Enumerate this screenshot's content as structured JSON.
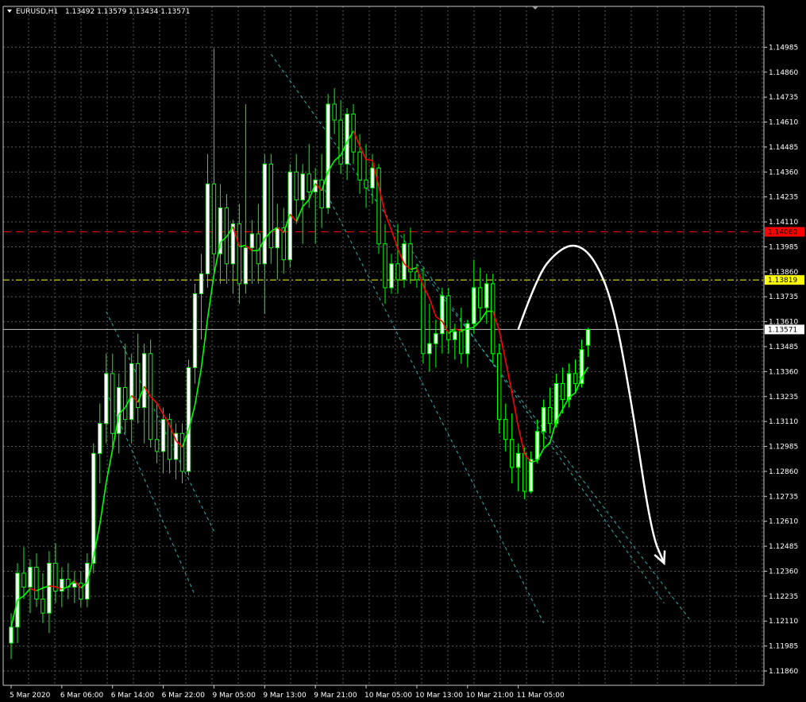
{
  "colors": {
    "background": "#000000",
    "grid": "#5a5a5a",
    "bull_body": "#ffffff",
    "bull_outline": "#00ff00",
    "bear_body": "#000000",
    "bear_outline": "#00ff00",
    "wick": "#00ff00",
    "ma_up": "#00ff00",
    "ma_down": "#ff0000",
    "channel": "#20b2aa",
    "resistance": "#ff0000",
    "support": "#ffff00",
    "current": "#c0c0c0",
    "projection": "#ffffff"
  },
  "chart_data": {
    "type": "candlestick",
    "symbol": "EURUSD,H1",
    "header": {
      "symbol_label": "EURUSD,H1",
      "ohlc_text": "1.13492 1.13579 1.13434 1.13571"
    },
    "ylim": [
      1.1186,
      1.1511
    ],
    "y_ticks": [
      "1.14985",
      "1.14860",
      "1.14735",
      "1.14610",
      "1.14485",
      "1.14360",
      "1.14235",
      "1.14110",
      "1.13985",
      "1.13860",
      "1.13735",
      "1.13610",
      "1.13485",
      "1.13360",
      "1.13235",
      "1.13110",
      "1.12985",
      "1.12860",
      "1.12735",
      "1.12610",
      "1.12485",
      "1.12360",
      "1.12235",
      "1.12110",
      "1.11985",
      "1.11860"
    ],
    "x_tick_labels": [
      "5 Mar 2020",
      "6 Mar 06:00",
      "6 Mar 14:00",
      "6 Mar 22:00",
      "9 Mar 05:00",
      "9 Mar 13:00",
      "9 Mar 21:00",
      "10 Mar 05:00",
      "10 Mar 13:00",
      "10 Mar 21:00",
      "11 Mar 05:00"
    ],
    "x_tick_bars": [
      0,
      8,
      16,
      24,
      32,
      40,
      48,
      56,
      64,
      72,
      80
    ],
    "bars_visible_span": 120,
    "candles": [
      {
        "o": 1.12,
        "h": 1.1215,
        "l": 1.1192,
        "c": 1.1208
      },
      {
        "o": 1.1208,
        "h": 1.124,
        "l": 1.12,
        "c": 1.1235
      },
      {
        "o": 1.1235,
        "h": 1.1248,
        "l": 1.1222,
        "c": 1.1228
      },
      {
        "o": 1.1228,
        "h": 1.1242,
        "l": 1.1215,
        "c": 1.1238
      },
      {
        "o": 1.1238,
        "h": 1.1245,
        "l": 1.1218,
        "c": 1.1222
      },
      {
        "o": 1.1222,
        "h": 1.1235,
        "l": 1.121,
        "c": 1.1215
      },
      {
        "o": 1.1215,
        "h": 1.1246,
        "l": 1.1205,
        "c": 1.124
      },
      {
        "o": 1.124,
        "h": 1.125,
        "l": 1.122,
        "c": 1.1226
      },
      {
        "o": 1.1226,
        "h": 1.1238,
        "l": 1.1218,
        "c": 1.1232
      },
      {
        "o": 1.1232,
        "h": 1.124,
        "l": 1.1222,
        "c": 1.1228
      },
      {
        "o": 1.1228,
        "h": 1.1236,
        "l": 1.122,
        "c": 1.123
      },
      {
        "o": 1.123,
        "h": 1.1236,
        "l": 1.1218,
        "c": 1.1222
      },
      {
        "o": 1.1222,
        "h": 1.1245,
        "l": 1.1218,
        "c": 1.124
      },
      {
        "o": 1.124,
        "h": 1.13,
        "l": 1.1235,
        "c": 1.1295
      },
      {
        "o": 1.1295,
        "h": 1.132,
        "l": 1.128,
        "c": 1.131
      },
      {
        "o": 1.131,
        "h": 1.1345,
        "l": 1.13,
        "c": 1.1335
      },
      {
        "o": 1.1335,
        "h": 1.1345,
        "l": 1.1298,
        "c": 1.1305
      },
      {
        "o": 1.1305,
        "h": 1.1335,
        "l": 1.1295,
        "c": 1.1328
      },
      {
        "o": 1.1328,
        "h": 1.135,
        "l": 1.1305,
        "c": 1.1312
      },
      {
        "o": 1.1312,
        "h": 1.1345,
        "l": 1.13,
        "c": 1.134
      },
      {
        "o": 1.134,
        "h": 1.1355,
        "l": 1.131,
        "c": 1.1318
      },
      {
        "o": 1.1318,
        "h": 1.135,
        "l": 1.13,
        "c": 1.1345
      },
      {
        "o": 1.1345,
        "h": 1.1352,
        "l": 1.1298,
        "c": 1.1302
      },
      {
        "o": 1.1302,
        "h": 1.132,
        "l": 1.129,
        "c": 1.1296
      },
      {
        "o": 1.1296,
        "h": 1.1318,
        "l": 1.1285,
        "c": 1.1312
      },
      {
        "o": 1.1312,
        "h": 1.1315,
        "l": 1.1285,
        "c": 1.1292
      },
      {
        "o": 1.1292,
        "h": 1.131,
        "l": 1.1282,
        "c": 1.1305
      },
      {
        "o": 1.1305,
        "h": 1.131,
        "l": 1.128,
        "c": 1.1286
      },
      {
        "o": 1.1286,
        "h": 1.1342,
        "l": 1.1284,
        "c": 1.1338
      },
      {
        "o": 1.1338,
        "h": 1.138,
        "l": 1.133,
        "c": 1.1375
      },
      {
        "o": 1.1375,
        "h": 1.1395,
        "l": 1.1352,
        "c": 1.1385
      },
      {
        "o": 1.1385,
        "h": 1.1445,
        "l": 1.1378,
        "c": 1.143
      },
      {
        "o": 1.143,
        "h": 1.1498,
        "l": 1.1385,
        "c": 1.1395
      },
      {
        "o": 1.1395,
        "h": 1.143,
        "l": 1.138,
        "c": 1.1418
      },
      {
        "o": 1.1418,
        "h": 1.1425,
        "l": 1.138,
        "c": 1.139
      },
      {
        "o": 1.139,
        "h": 1.1412,
        "l": 1.1375,
        "c": 1.141
      },
      {
        "o": 1.141,
        "h": 1.142,
        "l": 1.137,
        "c": 1.138
      },
      {
        "o": 1.138,
        "h": 1.147,
        "l": 1.1375,
        "c": 1.1398
      },
      {
        "o": 1.1398,
        "h": 1.1412,
        "l": 1.138,
        "c": 1.1405
      },
      {
        "o": 1.1405,
        "h": 1.142,
        "l": 1.138,
        "c": 1.139
      },
      {
        "o": 1.139,
        "h": 1.1445,
        "l": 1.1365,
        "c": 1.144
      },
      {
        "o": 1.144,
        "h": 1.1445,
        "l": 1.139,
        "c": 1.1398
      },
      {
        "o": 1.1398,
        "h": 1.142,
        "l": 1.1382,
        "c": 1.1408
      },
      {
        "o": 1.1408,
        "h": 1.1418,
        "l": 1.1385,
        "c": 1.1392
      },
      {
        "o": 1.1392,
        "h": 1.144,
        "l": 1.1388,
        "c": 1.1436
      },
      {
        "o": 1.1436,
        "h": 1.1445,
        "l": 1.141,
        "c": 1.1422
      },
      {
        "o": 1.1422,
        "h": 1.144,
        "l": 1.14,
        "c": 1.1435
      },
      {
        "o": 1.1435,
        "h": 1.145,
        "l": 1.1418,
        "c": 1.1426
      },
      {
        "o": 1.1426,
        "h": 1.1438,
        "l": 1.14,
        "c": 1.1432
      },
      {
        "o": 1.1432,
        "h": 1.1445,
        "l": 1.1408,
        "c": 1.1418
      },
      {
        "o": 1.1418,
        "h": 1.1475,
        "l": 1.1415,
        "c": 1.147
      },
      {
        "o": 1.147,
        "h": 1.1478,
        "l": 1.1455,
        "c": 1.1462
      },
      {
        "o": 1.1462,
        "h": 1.1472,
        "l": 1.1435,
        "c": 1.144
      },
      {
        "o": 1.144,
        "h": 1.1468,
        "l": 1.1432,
        "c": 1.1465
      },
      {
        "o": 1.1465,
        "h": 1.147,
        "l": 1.144,
        "c": 1.1446
      },
      {
        "o": 1.1446,
        "h": 1.1455,
        "l": 1.1425,
        "c": 1.1432
      },
      {
        "o": 1.1432,
        "h": 1.145,
        "l": 1.1418,
        "c": 1.1428
      },
      {
        "o": 1.1428,
        "h": 1.1445,
        "l": 1.142,
        "c": 1.1438
      },
      {
        "o": 1.1438,
        "h": 1.144,
        "l": 1.1395,
        "c": 1.14
      },
      {
        "o": 1.14,
        "h": 1.141,
        "l": 1.137,
        "c": 1.1378
      },
      {
        "o": 1.1378,
        "h": 1.1395,
        "l": 1.1375,
        "c": 1.139
      },
      {
        "o": 1.139,
        "h": 1.141,
        "l": 1.1375,
        "c": 1.1382
      },
      {
        "o": 1.1382,
        "h": 1.1405,
        "l": 1.1378,
        "c": 1.14
      },
      {
        "o": 1.14,
        "h": 1.1408,
        "l": 1.138,
        "c": 1.1386
      },
      {
        "o": 1.1386,
        "h": 1.139,
        "l": 1.1378,
        "c": 1.1382
      },
      {
        "o": 1.1382,
        "h": 1.1388,
        "l": 1.134,
        "c": 1.1345
      },
      {
        "o": 1.1345,
        "h": 1.137,
        "l": 1.1336,
        "c": 1.135
      },
      {
        "o": 1.135,
        "h": 1.1362,
        "l": 1.1338,
        "c": 1.1355
      },
      {
        "o": 1.1355,
        "h": 1.1378,
        "l": 1.1345,
        "c": 1.1374
      },
      {
        "o": 1.1374,
        "h": 1.1378,
        "l": 1.1345,
        "c": 1.1352
      },
      {
        "o": 1.1352,
        "h": 1.136,
        "l": 1.1342,
        "c": 1.1356
      },
      {
        "o": 1.1356,
        "h": 1.1368,
        "l": 1.134,
        "c": 1.1345
      },
      {
        "o": 1.1345,
        "h": 1.1362,
        "l": 1.1338,
        "c": 1.136
      },
      {
        "o": 1.136,
        "h": 1.1392,
        "l": 1.1355,
        "c": 1.1378
      },
      {
        "o": 1.1378,
        "h": 1.1388,
        "l": 1.1362,
        "c": 1.1368
      },
      {
        "o": 1.1368,
        "h": 1.1385,
        "l": 1.136,
        "c": 1.138
      },
      {
        "o": 1.138,
        "h": 1.1385,
        "l": 1.134,
        "c": 1.1345
      },
      {
        "o": 1.1345,
        "h": 1.135,
        "l": 1.1305,
        "c": 1.1312
      },
      {
        "o": 1.1312,
        "h": 1.132,
        "l": 1.1296,
        "c": 1.1302
      },
      {
        "o": 1.1302,
        "h": 1.1315,
        "l": 1.128,
        "c": 1.1288
      },
      {
        "o": 1.1288,
        "h": 1.13,
        "l": 1.1276,
        "c": 1.1295
      },
      {
        "o": 1.1295,
        "h": 1.1298,
        "l": 1.1272,
        "c": 1.1276
      },
      {
        "o": 1.1276,
        "h": 1.1296,
        "l": 1.1275,
        "c": 1.1292
      },
      {
        "o": 1.1292,
        "h": 1.1312,
        "l": 1.129,
        "c": 1.1306
      },
      {
        "o": 1.1306,
        "h": 1.1322,
        "l": 1.1298,
        "c": 1.1318
      },
      {
        "o": 1.1318,
        "h": 1.1328,
        "l": 1.1305,
        "c": 1.131
      },
      {
        "o": 1.131,
        "h": 1.1335,
        "l": 1.1308,
        "c": 1.133
      },
      {
        "o": 1.133,
        "h": 1.1338,
        "l": 1.1315,
        "c": 1.1322
      },
      {
        "o": 1.1322,
        "h": 1.134,
        "l": 1.1318,
        "c": 1.1335
      },
      {
        "o": 1.1335,
        "h": 1.1342,
        "l": 1.1325,
        "c": 1.133
      },
      {
        "o": 1.133,
        "h": 1.1352,
        "l": 1.1328,
        "c": 1.1347
      },
      {
        "o": 1.13492,
        "h": 1.13579,
        "l": 1.13434,
        "c": 1.13571
      }
    ],
    "moving_average": {
      "period": 5,
      "up_color_key": "ma_up",
      "down_color_key": "ma_down"
    },
    "levels": {
      "resistance": {
        "price": 1.1406,
        "label": "1.14060"
      },
      "support": {
        "price": 1.13819,
        "label": "1.13819"
      },
      "current": {
        "price": 1.13571,
        "label": "1.13571"
      }
    },
    "channels": [
      {
        "p1": {
          "bar": 15,
          "price": 1.1366
        },
        "p2": {
          "bar": 32,
          "price": 1.1256
        }
      },
      {
        "p1": {
          "bar": 15,
          "price": 1.1326
        },
        "p2": {
          "bar": 29,
          "price": 1.1224
        }
      },
      {
        "p1": {
          "bar": 41,
          "price": 1.1495
        },
        "p2": {
          "bar": 103,
          "price": 1.122
        }
      },
      {
        "p1": {
          "bar": 49,
          "price": 1.143
        },
        "p2": {
          "bar": 84,
          "price": 1.121
        }
      },
      {
        "p1": {
          "bar": 64,
          "price": 1.139
        },
        "p2": {
          "bar": 107,
          "price": 1.1212
        }
      }
    ],
    "projection": {
      "points": [
        {
          "bar": 80,
          "price": 1.13571
        },
        {
          "bar": 83,
          "price": 1.1384
        },
        {
          "bar": 86,
          "price": 1.1396
        },
        {
          "bar": 89,
          "price": 1.14005
        },
        {
          "bar": 92,
          "price": 1.1393
        },
        {
          "bar": 95,
          "price": 1.137
        },
        {
          "bar": 98,
          "price": 1.1318
        },
        {
          "bar": 101,
          "price": 1.1255
        },
        {
          "bar": 103,
          "price": 1.124
        }
      ]
    }
  }
}
